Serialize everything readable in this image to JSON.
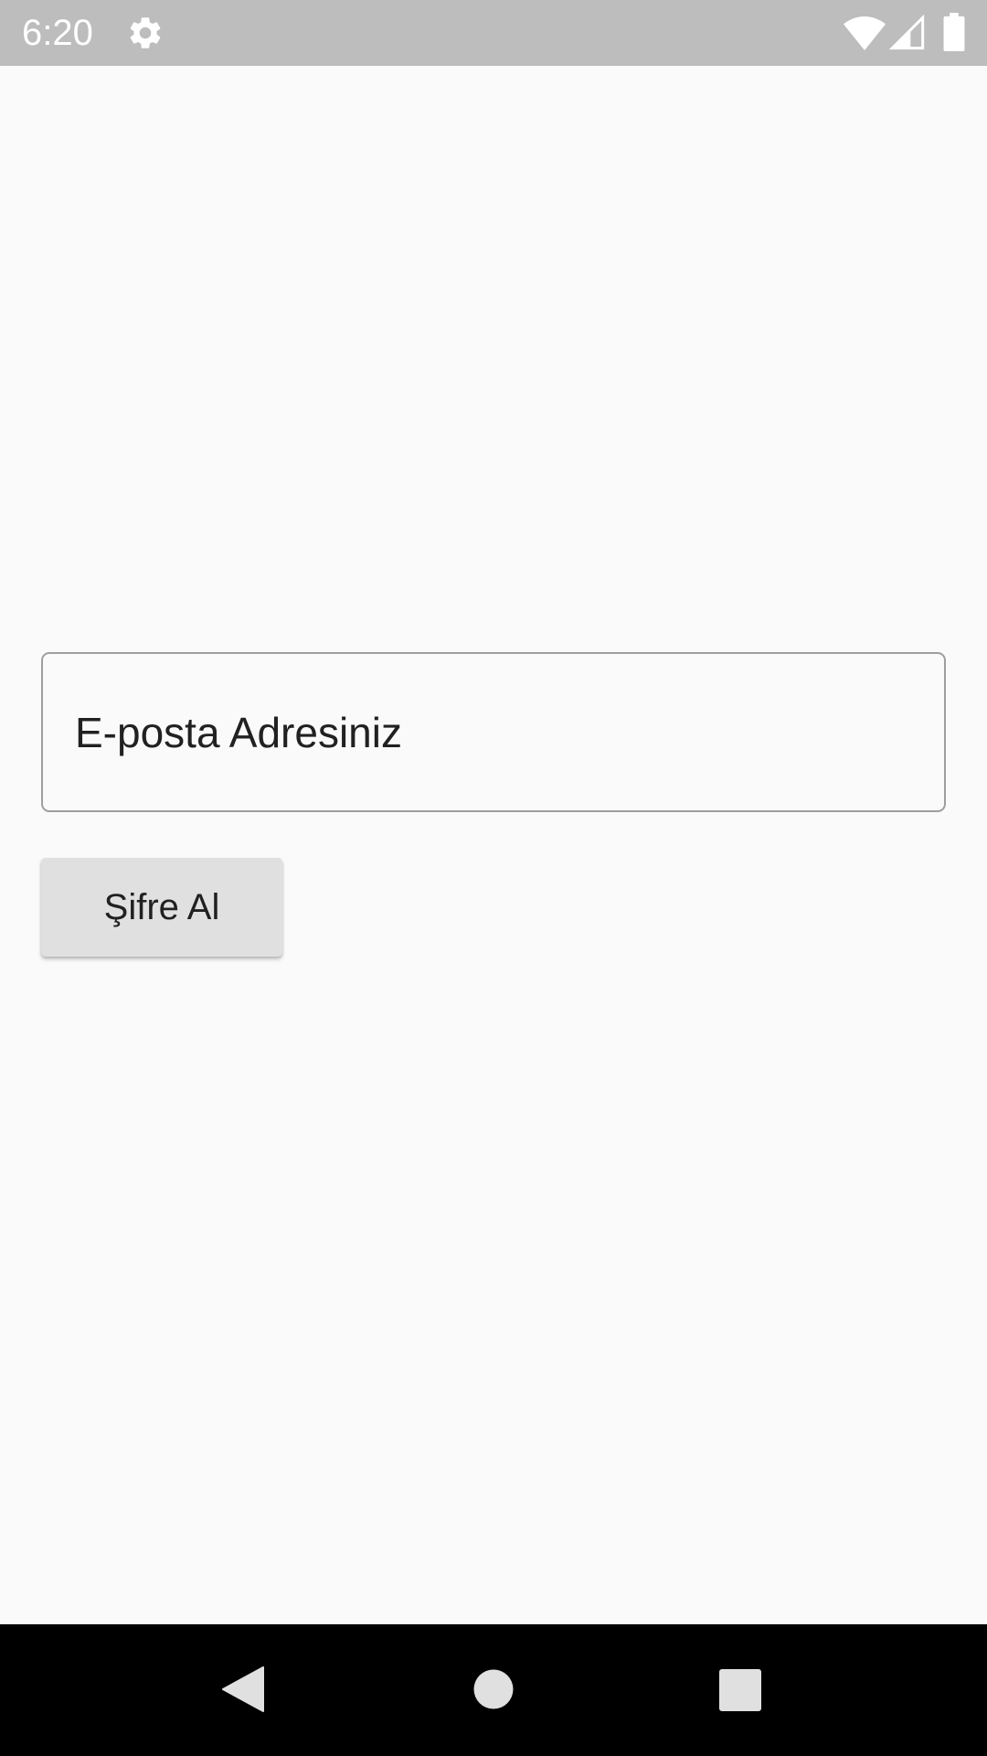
{
  "status_bar": {
    "time": "6:20",
    "icons": [
      "gear-icon",
      "wifi-icon",
      "cell-signal-icon",
      "battery-icon"
    ]
  },
  "form": {
    "email_placeholder": "E-posta Adresiniz",
    "submit_label": "Şifre Al"
  },
  "nav_bar": {
    "icons": [
      "back-icon",
      "home-icon",
      "recents-icon"
    ]
  },
  "colors": {
    "background": "#fafafa",
    "status_bar": "#bdbdbd",
    "button": "#e0e0e0",
    "field_border": "#9e9e9e",
    "nav_bar": "#000000"
  }
}
